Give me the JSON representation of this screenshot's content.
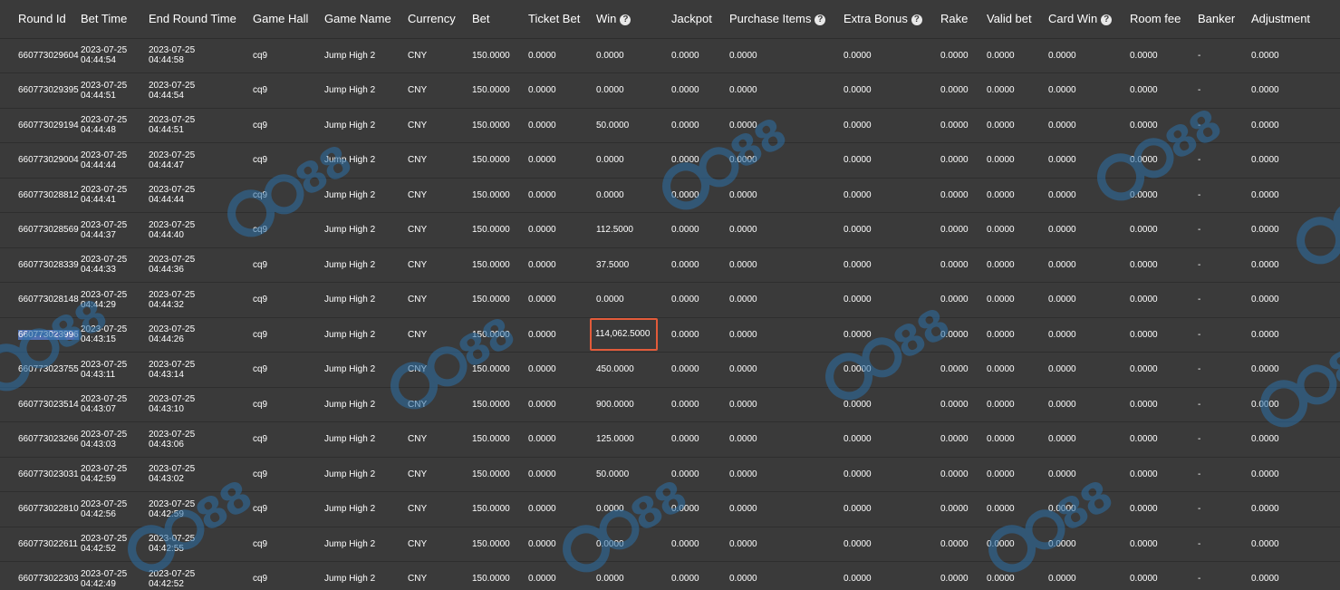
{
  "columns": [
    {
      "key": "round_id",
      "label": "Round Id",
      "help": false
    },
    {
      "key": "bet_time",
      "label": "Bet Time",
      "help": false
    },
    {
      "key": "end_round_time",
      "label": "End Round Time",
      "help": false
    },
    {
      "key": "game_hall",
      "label": "Game Hall",
      "help": false
    },
    {
      "key": "game_name",
      "label": "Game Name",
      "help": false
    },
    {
      "key": "currency",
      "label": "Currency",
      "help": false
    },
    {
      "key": "bet",
      "label": "Bet",
      "help": false
    },
    {
      "key": "ticket_bet",
      "label": "Ticket Bet",
      "help": false
    },
    {
      "key": "win",
      "label": "Win",
      "help": true
    },
    {
      "key": "jackpot",
      "label": "Jackpot",
      "help": false
    },
    {
      "key": "purchase_items",
      "label": "Purchase Items",
      "help": true
    },
    {
      "key": "extra_bonus",
      "label": "Extra Bonus",
      "help": true
    },
    {
      "key": "rake",
      "label": "Rake",
      "help": false
    },
    {
      "key": "valid_bet",
      "label": "Valid bet",
      "help": false
    },
    {
      "key": "card_win",
      "label": "Card Win",
      "help": true
    },
    {
      "key": "room_fee",
      "label": "Room fee",
      "help": false
    },
    {
      "key": "banker",
      "label": "Banker",
      "help": false
    },
    {
      "key": "adjustment",
      "label": "Adjustment",
      "help": false
    }
  ],
  "help_glyph": "?",
  "highlighted_round_id": "660773023996",
  "highlighted_win_round_id": "660773023996",
  "rows": [
    {
      "round_id": "660773029604",
      "bet_date": "2023-07-25",
      "bet_clock": "04:44:54",
      "end_date": "2023-07-25",
      "end_clock": "04:44:58",
      "game_hall": "cq9",
      "game_name": "Jump High 2",
      "currency": "CNY",
      "bet": "150.0000",
      "ticket_bet": "0.0000",
      "win": "0.0000",
      "jackpot": "0.0000",
      "purchase_items": "0.0000",
      "extra_bonus": "0.0000",
      "rake": "0.0000",
      "valid_bet": "0.0000",
      "card_win": "0.0000",
      "room_fee": "0.0000",
      "banker": "-",
      "adjustment": "0.0000"
    },
    {
      "round_id": "660773029395",
      "bet_date": "2023-07-25",
      "bet_clock": "04:44:51",
      "end_date": "2023-07-25",
      "end_clock": "04:44:54",
      "game_hall": "cq9",
      "game_name": "Jump High 2",
      "currency": "CNY",
      "bet": "150.0000",
      "ticket_bet": "0.0000",
      "win": "0.0000",
      "jackpot": "0.0000",
      "purchase_items": "0.0000",
      "extra_bonus": "0.0000",
      "rake": "0.0000",
      "valid_bet": "0.0000",
      "card_win": "0.0000",
      "room_fee": "0.0000",
      "banker": "-",
      "adjustment": "0.0000"
    },
    {
      "round_id": "660773029194",
      "bet_date": "2023-07-25",
      "bet_clock": "04:44:48",
      "end_date": "2023-07-25",
      "end_clock": "04:44:51",
      "game_hall": "cq9",
      "game_name": "Jump High 2",
      "currency": "CNY",
      "bet": "150.0000",
      "ticket_bet": "0.0000",
      "win": "50.0000",
      "jackpot": "0.0000",
      "purchase_items": "0.0000",
      "extra_bonus": "0.0000",
      "rake": "0.0000",
      "valid_bet": "0.0000",
      "card_win": "0.0000",
      "room_fee": "0.0000",
      "banker": "-",
      "adjustment": "0.0000"
    },
    {
      "round_id": "660773029004",
      "bet_date": "2023-07-25",
      "bet_clock": "04:44:44",
      "end_date": "2023-07-25",
      "end_clock": "04:44:47",
      "game_hall": "cq9",
      "game_name": "Jump High 2",
      "currency": "CNY",
      "bet": "150.0000",
      "ticket_bet": "0.0000",
      "win": "0.0000",
      "jackpot": "0.0000",
      "purchase_items": "0.0000",
      "extra_bonus": "0.0000",
      "rake": "0.0000",
      "valid_bet": "0.0000",
      "card_win": "0.0000",
      "room_fee": "0.0000",
      "banker": "-",
      "adjustment": "0.0000"
    },
    {
      "round_id": "660773028812",
      "bet_date": "2023-07-25",
      "bet_clock": "04:44:41",
      "end_date": "2023-07-25",
      "end_clock": "04:44:44",
      "game_hall": "cq9",
      "game_name": "Jump High 2",
      "currency": "CNY",
      "bet": "150.0000",
      "ticket_bet": "0.0000",
      "win": "0.0000",
      "jackpot": "0.0000",
      "purchase_items": "0.0000",
      "extra_bonus": "0.0000",
      "rake": "0.0000",
      "valid_bet": "0.0000",
      "card_win": "0.0000",
      "room_fee": "0.0000",
      "banker": "-",
      "adjustment": "0.0000"
    },
    {
      "round_id": "660773028569",
      "bet_date": "2023-07-25",
      "bet_clock": "04:44:37",
      "end_date": "2023-07-25",
      "end_clock": "04:44:40",
      "game_hall": "cq9",
      "game_name": "Jump High 2",
      "currency": "CNY",
      "bet": "150.0000",
      "ticket_bet": "0.0000",
      "win": "112.5000",
      "jackpot": "0.0000",
      "purchase_items": "0.0000",
      "extra_bonus": "0.0000",
      "rake": "0.0000",
      "valid_bet": "0.0000",
      "card_win": "0.0000",
      "room_fee": "0.0000",
      "banker": "-",
      "adjustment": "0.0000"
    },
    {
      "round_id": "660773028339",
      "bet_date": "2023-07-25",
      "bet_clock": "04:44:33",
      "end_date": "2023-07-25",
      "end_clock": "04:44:36",
      "game_hall": "cq9",
      "game_name": "Jump High 2",
      "currency": "CNY",
      "bet": "150.0000",
      "ticket_bet": "0.0000",
      "win": "37.5000",
      "jackpot": "0.0000",
      "purchase_items": "0.0000",
      "extra_bonus": "0.0000",
      "rake": "0.0000",
      "valid_bet": "0.0000",
      "card_win": "0.0000",
      "room_fee": "0.0000",
      "banker": "-",
      "adjustment": "0.0000"
    },
    {
      "round_id": "660773028148",
      "bet_date": "2023-07-25",
      "bet_clock": "04:44:29",
      "end_date": "2023-07-25",
      "end_clock": "04:44:32",
      "game_hall": "cq9",
      "game_name": "Jump High 2",
      "currency": "CNY",
      "bet": "150.0000",
      "ticket_bet": "0.0000",
      "win": "0.0000",
      "jackpot": "0.0000",
      "purchase_items": "0.0000",
      "extra_bonus": "0.0000",
      "rake": "0.0000",
      "valid_bet": "0.0000",
      "card_win": "0.0000",
      "room_fee": "0.0000",
      "banker": "-",
      "adjustment": "0.0000"
    },
    {
      "round_id": "660773023996",
      "bet_date": "2023-07-25",
      "bet_clock": "04:43:15",
      "end_date": "2023-07-25",
      "end_clock": "04:44:26",
      "game_hall": "cq9",
      "game_name": "Jump High 2",
      "currency": "CNY",
      "bet": "150.0000",
      "ticket_bet": "0.0000",
      "win": "114,062.5000",
      "jackpot": "0.0000",
      "purchase_items": "0.0000",
      "extra_bonus": "0.0000",
      "rake": "0.0000",
      "valid_bet": "0.0000",
      "card_win": "0.0000",
      "room_fee": "0.0000",
      "banker": "-",
      "adjustment": "0.0000"
    },
    {
      "round_id": "660773023755",
      "bet_date": "2023-07-25",
      "bet_clock": "04:43:11",
      "end_date": "2023-07-25",
      "end_clock": "04:43:14",
      "game_hall": "cq9",
      "game_name": "Jump High 2",
      "currency": "CNY",
      "bet": "150.0000",
      "ticket_bet": "0.0000",
      "win": "450.0000",
      "jackpot": "0.0000",
      "purchase_items": "0.0000",
      "extra_bonus": "0.0000",
      "rake": "0.0000",
      "valid_bet": "0.0000",
      "card_win": "0.0000",
      "room_fee": "0.0000",
      "banker": "-",
      "adjustment": "0.0000"
    },
    {
      "round_id": "660773023514",
      "bet_date": "2023-07-25",
      "bet_clock": "04:43:07",
      "end_date": "2023-07-25",
      "end_clock": "04:43:10",
      "game_hall": "cq9",
      "game_name": "Jump High 2",
      "currency": "CNY",
      "bet": "150.0000",
      "ticket_bet": "0.0000",
      "win": "900.0000",
      "jackpot": "0.0000",
      "purchase_items": "0.0000",
      "extra_bonus": "0.0000",
      "rake": "0.0000",
      "valid_bet": "0.0000",
      "card_win": "0.0000",
      "room_fee": "0.0000",
      "banker": "-",
      "adjustment": "0.0000"
    },
    {
      "round_id": "660773023266",
      "bet_date": "2023-07-25",
      "bet_clock": "04:43:03",
      "end_date": "2023-07-25",
      "end_clock": "04:43:06",
      "game_hall": "cq9",
      "game_name": "Jump High 2",
      "currency": "CNY",
      "bet": "150.0000",
      "ticket_bet": "0.0000",
      "win": "125.0000",
      "jackpot": "0.0000",
      "purchase_items": "0.0000",
      "extra_bonus": "0.0000",
      "rake": "0.0000",
      "valid_bet": "0.0000",
      "card_win": "0.0000",
      "room_fee": "0.0000",
      "banker": "-",
      "adjustment": "0.0000"
    },
    {
      "round_id": "660773023031",
      "bet_date": "2023-07-25",
      "bet_clock": "04:42:59",
      "end_date": "2023-07-25",
      "end_clock": "04:43:02",
      "game_hall": "cq9",
      "game_name": "Jump High 2",
      "currency": "CNY",
      "bet": "150.0000",
      "ticket_bet": "0.0000",
      "win": "50.0000",
      "jackpot": "0.0000",
      "purchase_items": "0.0000",
      "extra_bonus": "0.0000",
      "rake": "0.0000",
      "valid_bet": "0.0000",
      "card_win": "0.0000",
      "room_fee": "0.0000",
      "banker": "-",
      "adjustment": "0.0000"
    },
    {
      "round_id": "660773022810",
      "bet_date": "2023-07-25",
      "bet_clock": "04:42:56",
      "end_date": "2023-07-25",
      "end_clock": "04:42:59",
      "game_hall": "cq9",
      "game_name": "Jump High 2",
      "currency": "CNY",
      "bet": "150.0000",
      "ticket_bet": "0.0000",
      "win": "0.0000",
      "jackpot": "0.0000",
      "purchase_items": "0.0000",
      "extra_bonus": "0.0000",
      "rake": "0.0000",
      "valid_bet": "0.0000",
      "card_win": "0.0000",
      "room_fee": "0.0000",
      "banker": "-",
      "adjustment": "0.0000"
    },
    {
      "round_id": "660773022611",
      "bet_date": "2023-07-25",
      "bet_clock": "04:42:52",
      "end_date": "2023-07-25",
      "end_clock": "04:42:55",
      "game_hall": "cq9",
      "game_name": "Jump High 2",
      "currency": "CNY",
      "bet": "150.0000",
      "ticket_bet": "0.0000",
      "win": "0.0000",
      "jackpot": "0.0000",
      "purchase_items": "0.0000",
      "extra_bonus": "0.0000",
      "rake": "0.0000",
      "valid_bet": "0.0000",
      "card_win": "0.0000",
      "room_fee": "0.0000",
      "banker": "-",
      "adjustment": "0.0000"
    },
    {
      "round_id": "660773022303",
      "bet_date": "2023-07-25",
      "bet_clock": "04:42:49",
      "end_date": "2023-07-25",
      "end_clock": "04:42:52",
      "game_hall": "cq9",
      "game_name": "Jump High 2",
      "currency": "CNY",
      "bet": "150.0000",
      "ticket_bet": "0.0000",
      "win": "0.0000",
      "jackpot": "0.0000",
      "purchase_items": "0.0000",
      "extra_bonus": "0.0000",
      "rake": "0.0000",
      "valid_bet": "0.0000",
      "card_win": "0.0000",
      "room_fee": "0.0000",
      "banker": "-",
      "adjustment": "0.0000"
    }
  ],
  "watermark": {
    "text": "88",
    "color": "#2c6fa6"
  },
  "colors": {
    "background": "#3a3a3a",
    "text": "#ffffff",
    "highlight_border": "#e25b3a",
    "selection": "#4f6fb0"
  }
}
